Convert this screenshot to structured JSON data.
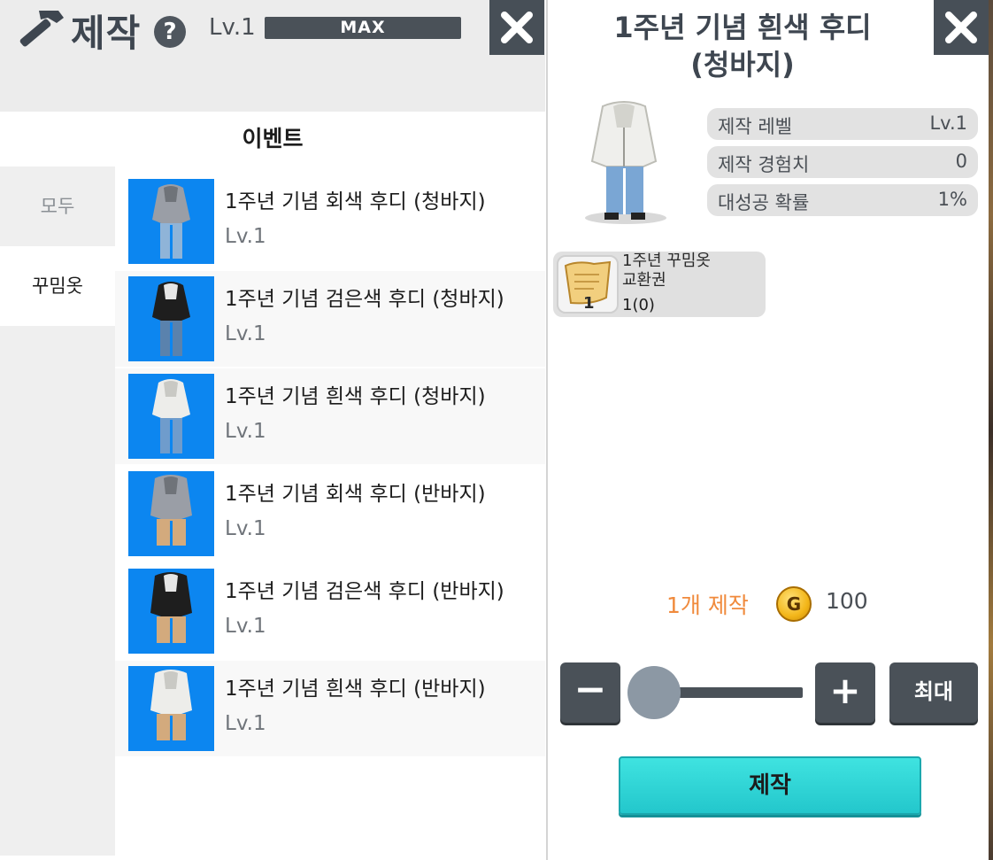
{
  "header": {
    "title": "제작",
    "help_icon": "question-icon",
    "level_label": "Lv.1",
    "level_bar_text": "MAX"
  },
  "section_title": "이벤트",
  "tabs": [
    {
      "label": "모두",
      "active": false
    },
    {
      "label": "꾸밈옷",
      "active": true
    }
  ],
  "items": [
    {
      "name": "1주년 기념 회색 후디 (청바지)",
      "level": "Lv.1"
    },
    {
      "name": "1주년 기념 검은색 후디 (청바지)",
      "level": "Lv.1"
    },
    {
      "name": "1주년 기념 흰색 후디 (청바지)",
      "level": "Lv.1"
    },
    {
      "name": "1주년 기념 회색 후디 (반바지)",
      "level": "Lv.1"
    },
    {
      "name": "1주년 기념 검은색 후디 (반바지)",
      "level": "Lv.1"
    },
    {
      "name": "1주년 기념 흰색 후디 (반바지)",
      "level": "Lv.1"
    }
  ],
  "detail": {
    "title_line1": "1주년 기념 흰색 후디",
    "title_line2": "(청바지)",
    "stats": [
      {
        "label": "제작 레벨",
        "value": "Lv.1"
      },
      {
        "label": "제작 경험치",
        "value": "0"
      },
      {
        "label": "대성공 확률",
        "value": "1%"
      }
    ],
    "material": {
      "name_line1": "1주년 꾸밈옷",
      "name_line2": "교환권",
      "count": "1(0)",
      "badge": "1"
    },
    "craft_count_label": "1개 제작",
    "currency_symbol": "G",
    "cost": "100",
    "quantity_fraction": 0,
    "minus_label": "−",
    "plus_label": "+",
    "max_label": "최대",
    "craft_label": "제작"
  },
  "colors": {
    "accent_blue": "#0c86f0",
    "craft_button": "#2fd6d6",
    "craft_count_orange": "#f08a3c",
    "dark_button": "#4a5158"
  }
}
